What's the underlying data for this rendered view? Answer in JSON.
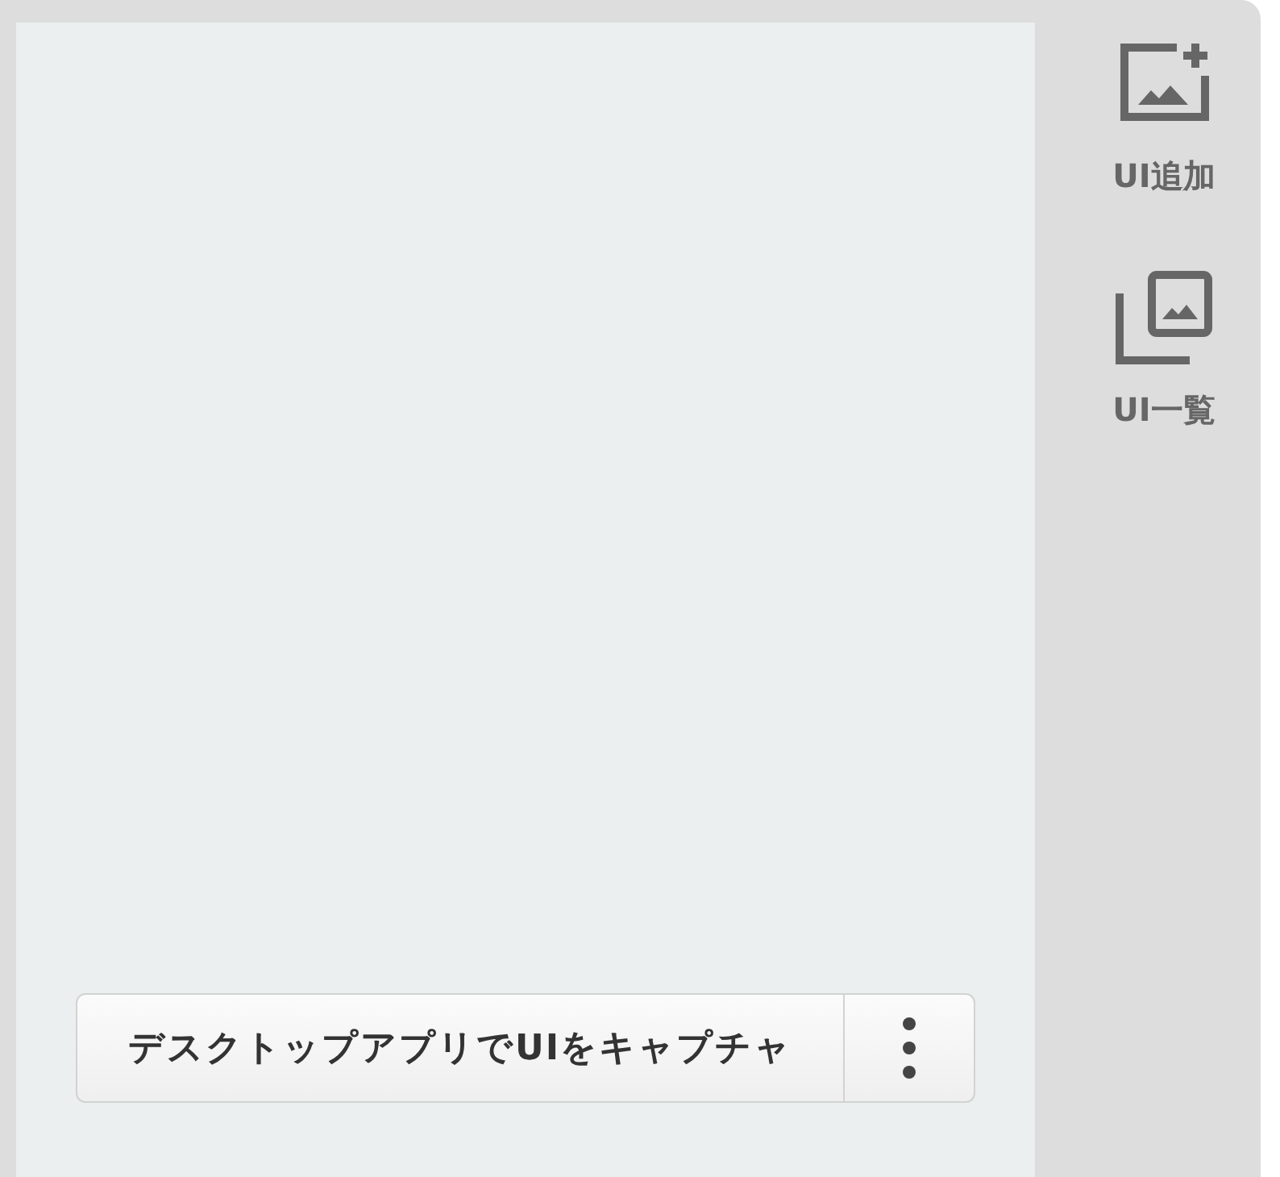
{
  "canvas": {
    "capture_button": {
      "label": "デスクトップアプリでUIをキャプチャ"
    },
    "menu_button": {
      "kind": "more"
    }
  },
  "sidebar": {
    "items": [
      {
        "label": "UI追加",
        "kind": "add"
      },
      {
        "label": "UI一覧",
        "kind": "list"
      }
    ]
  }
}
